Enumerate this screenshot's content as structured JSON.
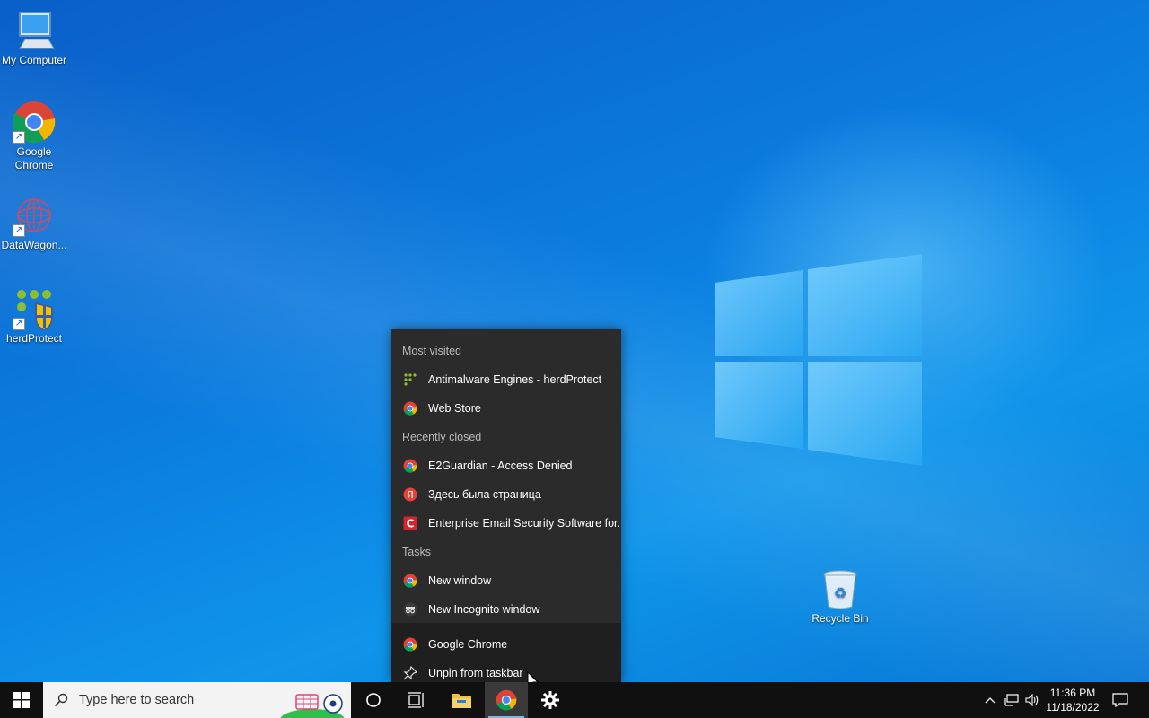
{
  "desktop": {
    "icons": [
      {
        "label": "My Computer",
        "icon": "computer-icon"
      },
      {
        "label": "Google Chrome",
        "icon": "chrome-icon"
      },
      {
        "label": "DataWagon...",
        "icon": "datawagon-icon"
      },
      {
        "label": "herdProtect",
        "icon": "herdprotect-icon"
      },
      {
        "label": "Recycle Bin",
        "icon": "recycle-bin-icon"
      }
    ]
  },
  "jumplist": {
    "most_visited_title": "Most visited",
    "most_visited": [
      {
        "label": "Antimalware Engines - herdProtect",
        "icon": "herdprotect-icon"
      },
      {
        "label": "Web Store",
        "icon": "chrome-icon"
      }
    ],
    "recently_closed_title": "Recently closed",
    "recently_closed": [
      {
        "label": "E2Guardian - Access Denied",
        "icon": "chrome-icon"
      },
      {
        "label": "Здесь была страница",
        "icon": "yandex-icon"
      },
      {
        "label": "Enterprise Email Security Software for...",
        "icon": "c-icon"
      }
    ],
    "tasks_title": "Tasks",
    "tasks": [
      {
        "label": "New window",
        "icon": "chrome-icon"
      },
      {
        "label": "New Incognito window",
        "icon": "incognito-icon"
      }
    ],
    "app": {
      "label": "Google Chrome",
      "icon": "chrome-icon"
    },
    "unpin": {
      "label": "Unpin from taskbar",
      "icon": "unpin-icon"
    }
  },
  "taskbar": {
    "search_placeholder": "Type here to search",
    "clock_time": "11:36 PM",
    "clock_date": "11/18/2022"
  },
  "colors": {
    "taskbar": "#101010",
    "jumplist_bg": "#2b2b2b",
    "accent": "#76b9ed"
  }
}
